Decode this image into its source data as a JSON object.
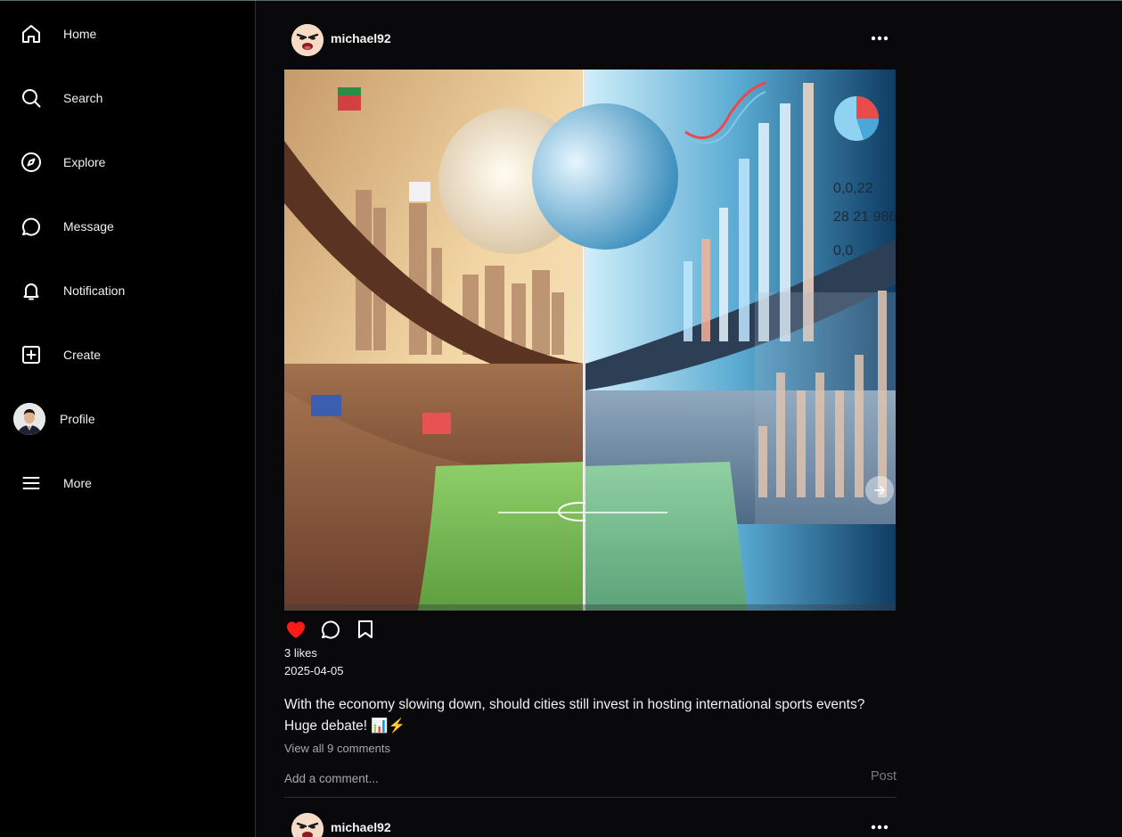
{
  "sidebar": {
    "items": [
      {
        "label": "Home",
        "icon": "home-icon"
      },
      {
        "label": "Search",
        "icon": "search-icon"
      },
      {
        "label": "Explore",
        "icon": "compass-icon"
      },
      {
        "label": "Message",
        "icon": "chat-bubble-icon"
      },
      {
        "label": "Notification",
        "icon": "bell-icon"
      },
      {
        "label": "Create",
        "icon": "plus-square-icon"
      },
      {
        "label": "Profile",
        "icon": "avatar"
      },
      {
        "label": "More",
        "icon": "hamburger-icon"
      }
    ]
  },
  "posts": [
    {
      "username": "michael92",
      "likes_text": "3 likes",
      "liked": true,
      "date": "2025-04-05",
      "caption": "With the economy slowing down, should cities still invest in hosting international sports events? Huge debate! 📊⚡",
      "view_comments": "View all 9 comments",
      "comment_placeholder": "Add a comment...",
      "post_label": "Post"
    },
    {
      "username": "michael92"
    }
  ],
  "colors": {
    "background": "#09090b",
    "like_red": "#ff1a1a",
    "muted_text": "#a8a8a8",
    "post_button": "#7a7a84"
  }
}
